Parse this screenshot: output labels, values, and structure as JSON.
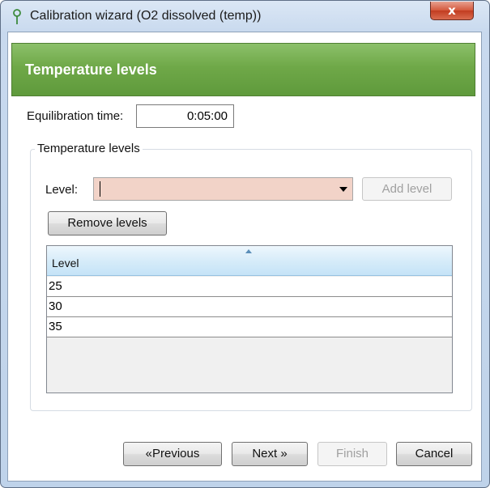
{
  "window": {
    "title": "Calibration wizard (O2 dissolved (temp))",
    "close_label": "x"
  },
  "header": {
    "title": "Temperature levels"
  },
  "equilibration": {
    "label": "Equilibration time:",
    "value": "0:05:00"
  },
  "temperature_group": {
    "caption": "Temperature levels",
    "level_label": "Level:",
    "level_value": "",
    "add_button": "Add level",
    "remove_button": "Remove levels",
    "table": {
      "column_header": "Level",
      "rows": [
        "25",
        "30",
        "35"
      ]
    }
  },
  "footer": {
    "previous_button": "«Previous",
    "next_button": "Next »",
    "finish_button": "Finish",
    "cancel_button": "Cancel"
  },
  "colors": {
    "header_green": "#6fa848",
    "combo_invalid": "#f2d3c8",
    "grid_header": "#d7ecf9"
  }
}
